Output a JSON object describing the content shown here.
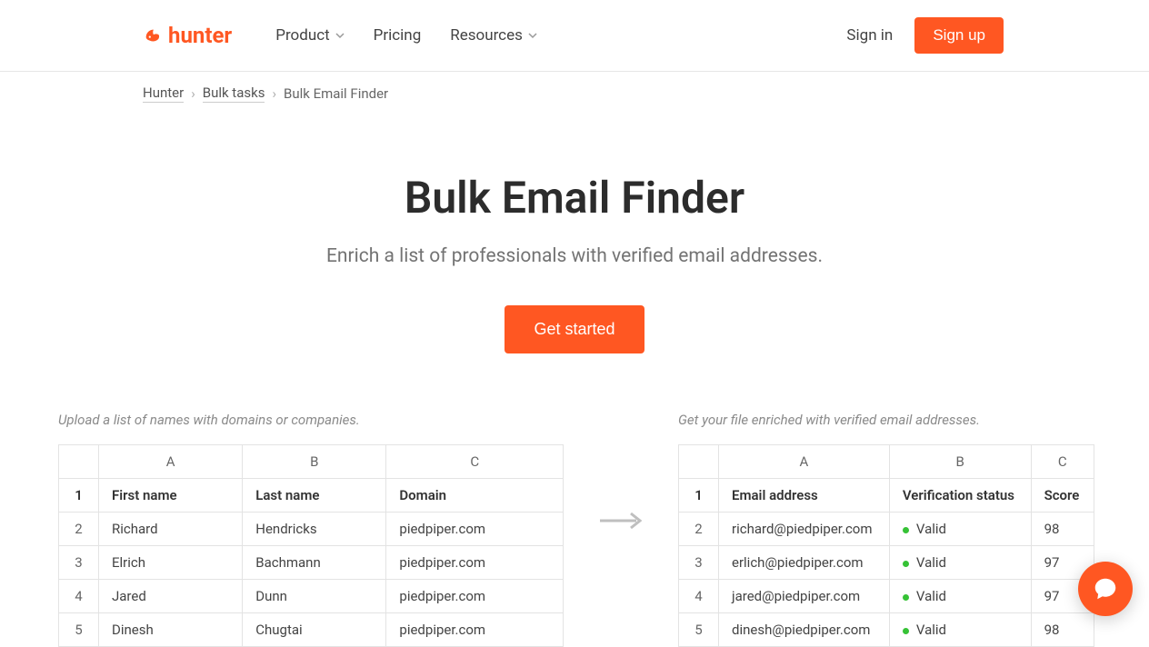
{
  "header": {
    "logo_text": "hunter",
    "nav": [
      "Product",
      "Pricing",
      "Resources"
    ],
    "signin": "Sign in",
    "signup": "Sign up"
  },
  "breadcrumb": {
    "items": [
      "Hunter",
      "Bulk tasks",
      "Bulk Email Finder"
    ]
  },
  "hero": {
    "title": "Bulk Email Finder",
    "subtitle": "Enrich a list of professionals with verified email addresses.",
    "cta": "Get started"
  },
  "left_table": {
    "caption": "Upload a list of names with domains or companies.",
    "cols": [
      "A",
      "B",
      "C"
    ],
    "header_row": [
      "First name",
      "Last name",
      "Domain"
    ],
    "rows": [
      [
        "Richard",
        "Hendricks",
        "piedpiper.com"
      ],
      [
        "Elrich",
        "Bachmann",
        "piedpiper.com"
      ],
      [
        "Jared",
        "Dunn",
        "piedpiper.com"
      ],
      [
        "Dinesh",
        "Chugtai",
        "piedpiper.com"
      ]
    ]
  },
  "right_table": {
    "caption": "Get your file enriched with verified email addresses.",
    "cols": [
      "A",
      "B",
      "C"
    ],
    "header_row": [
      "Email address",
      "Verification status",
      "Score"
    ],
    "rows": [
      {
        "email": "richard@piedpiper.com",
        "status": "Valid",
        "score": "98"
      },
      {
        "email": "erlich@piedpiper.com",
        "status": "Valid",
        "score": "97"
      },
      {
        "email": "jared@piedpiper.com",
        "status": "Valid",
        "score": "97"
      },
      {
        "email": "dinesh@piedpiper.com",
        "status": "Valid",
        "score": "98"
      }
    ]
  }
}
